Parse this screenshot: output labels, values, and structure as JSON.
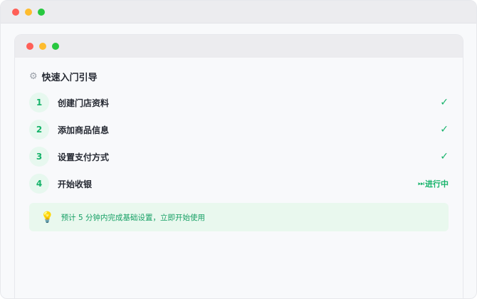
{
  "guide": {
    "title": "快速入门引导",
    "icon": "gear-icon",
    "steps": [
      {
        "number": "1",
        "label": "创建门店资料",
        "status": "completed",
        "status_glyph": "✓"
      },
      {
        "number": "2",
        "label": "添加商品信息",
        "status": "completed",
        "status_glyph": "✓"
      },
      {
        "number": "3",
        "label": "设置支付方式",
        "status": "completed",
        "status_glyph": "✓"
      },
      {
        "number": "4",
        "label": "开始收银",
        "status": "in-progress",
        "status_glyph": "⏭",
        "status_text": "进行中"
      }
    ],
    "tip": {
      "icon": "lightbulb-icon",
      "text": "预计 5 分钟内完成基础设置，立即开始使用"
    }
  },
  "colors": {
    "accent": "#16b36a",
    "accent_bg": "#e7f8ef",
    "tip_bg": "#e9f8ee"
  }
}
